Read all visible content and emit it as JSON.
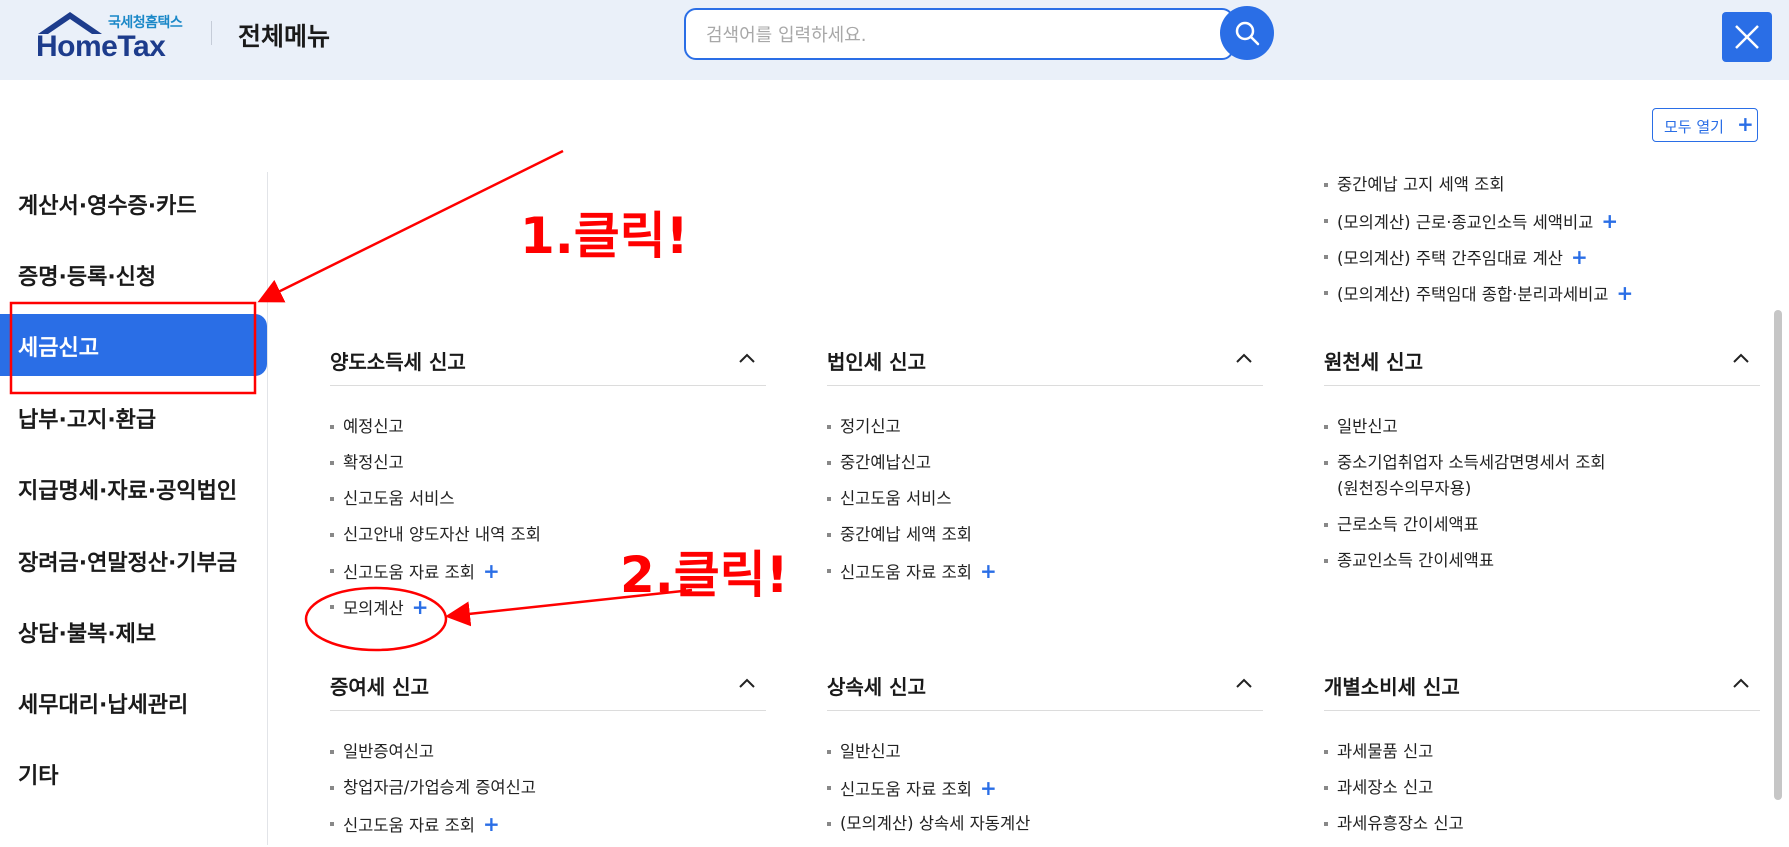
{
  "header": {
    "logo_sub": "국세청홈택스",
    "logo_main": "HomeTax",
    "title": "전체메뉴",
    "search_placeholder": "검색어를 입력하세요."
  },
  "open_all": {
    "label": "모두 열기",
    "icon": "+"
  },
  "sidebar": {
    "items": [
      {
        "label": "계산서·영수증·카드"
      },
      {
        "label": "증명·등록·신청"
      },
      {
        "label": "세금신고",
        "active": true
      },
      {
        "label": "납부·고지·환급"
      },
      {
        "label": "지급명세·자료·공익법인"
      },
      {
        "label": "장려금·연말정산·기부금"
      },
      {
        "label": "상담·불복·제보"
      },
      {
        "label": "세무대리·납세관리"
      },
      {
        "label": "기타"
      }
    ]
  },
  "top_list": [
    {
      "label": "중간예납 고지 세액 조회",
      "plus": ""
    },
    {
      "label": "(모의계산) 근로·종교인소득 세액비교",
      "plus": "+"
    },
    {
      "label": "(모의계산) 주택 간주임대료 계산",
      "plus": "+"
    },
    {
      "label": "(모의계산) 주택임대 종합·분리과세비교",
      "plus": "+"
    }
  ],
  "sections": [
    {
      "title": "양도소득세 신고",
      "items": [
        {
          "label": "예정신고",
          "plus": ""
        },
        {
          "label": "확정신고",
          "plus": ""
        },
        {
          "label": "신고도움 서비스",
          "plus": ""
        },
        {
          "label": "신고안내 양도자산 내역 조회",
          "plus": ""
        },
        {
          "label": "신고도움 자료 조회",
          "plus": "+"
        },
        {
          "label": "모의계산",
          "plus": "+"
        }
      ]
    },
    {
      "title": "법인세 신고",
      "items": [
        {
          "label": "정기신고",
          "plus": ""
        },
        {
          "label": "중간예납신고",
          "plus": ""
        },
        {
          "label": "신고도움 서비스",
          "plus": ""
        },
        {
          "label": "중간예납 세액 조회",
          "plus": ""
        },
        {
          "label": "신고도움 자료 조회",
          "plus": "+"
        }
      ]
    },
    {
      "title": "원천세 신고",
      "items": [
        {
          "label": "일반신고",
          "plus": ""
        },
        {
          "label": "중소기업취업자 소득세감면명세서 조회",
          "label2": "(원천징수의무자용)",
          "plus": ""
        },
        {
          "label": "근로소득 간이세액표",
          "plus": ""
        },
        {
          "label": "종교인소득 간이세액표",
          "plus": ""
        }
      ]
    },
    {
      "title": "증여세 신고",
      "items": [
        {
          "label": "일반증여신고",
          "plus": ""
        },
        {
          "label": "창업자금/가업승계 증여신고",
          "plus": ""
        },
        {
          "label": "신고도움 자료 조회",
          "plus": "+"
        }
      ]
    },
    {
      "title": "상속세 신고",
      "items": [
        {
          "label": "일반신고",
          "plus": ""
        },
        {
          "label": "신고도움 자료 조회",
          "plus": "+"
        },
        {
          "label": "(모의계산) 상속세 자동계산",
          "plus": ""
        }
      ]
    },
    {
      "title": "개별소비세 신고",
      "items": [
        {
          "label": "과세물품 신고",
          "plus": ""
        },
        {
          "label": "과세장소 신고",
          "plus": ""
        },
        {
          "label": "과세유흥장소 신고",
          "plus": ""
        }
      ]
    }
  ],
  "annotations": {
    "step1": "1.클릭!",
    "step2": "2.클릭!",
    "color": "#ff0000"
  }
}
